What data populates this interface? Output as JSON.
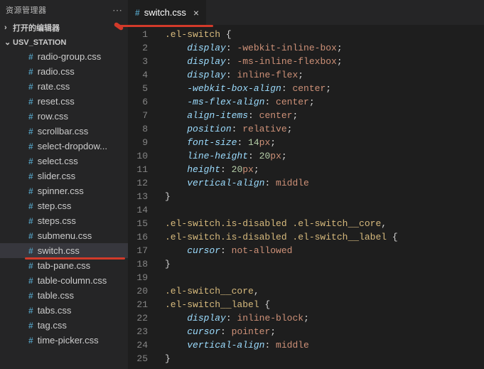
{
  "sidebar": {
    "title": "资源管理器",
    "sections": [
      {
        "label": "打开的编辑器",
        "expanded": false
      },
      {
        "label": "USV_STATION",
        "expanded": true
      }
    ],
    "files": [
      {
        "icon": "#",
        "name": "radio-group.css"
      },
      {
        "icon": "#",
        "name": "radio.css"
      },
      {
        "icon": "#",
        "name": "rate.css"
      },
      {
        "icon": "#",
        "name": "reset.css"
      },
      {
        "icon": "#",
        "name": "row.css"
      },
      {
        "icon": "#",
        "name": "scrollbar.css"
      },
      {
        "icon": "#",
        "name": "select-dropdow..."
      },
      {
        "icon": "#",
        "name": "select.css"
      },
      {
        "icon": "#",
        "name": "slider.css"
      },
      {
        "icon": "#",
        "name": "spinner.css"
      },
      {
        "icon": "#",
        "name": "step.css"
      },
      {
        "icon": "#",
        "name": "steps.css"
      },
      {
        "icon": "#",
        "name": "submenu.css"
      },
      {
        "icon": "#",
        "name": "switch.css",
        "active": true,
        "underline": true
      },
      {
        "icon": "#",
        "name": "tab-pane.css"
      },
      {
        "icon": "#",
        "name": "table-column.css"
      },
      {
        "icon": "#",
        "name": "table.css"
      },
      {
        "icon": "#",
        "name": "tabs.css"
      },
      {
        "icon": "#",
        "name": "tag.css"
      },
      {
        "icon": "#",
        "name": "time-picker.css"
      }
    ]
  },
  "tab": {
    "icon": "#",
    "label": "switch.css"
  },
  "chart_data": {
    "type": "table",
    "title": "switch.css source",
    "lines": [
      {
        "n": 1,
        "tokens": [
          {
            "t": ".el-switch",
            "c": "sel-yellow"
          },
          {
            "t": " {",
            "c": "brace"
          }
        ]
      },
      {
        "n": 2,
        "tokens": [
          {
            "t": "    "
          },
          {
            "t": "display",
            "c": "prop"
          },
          {
            "t": ": ",
            "c": "punct"
          },
          {
            "t": "-webkit-inline-box",
            "c": "val"
          },
          {
            "t": ";",
            "c": "punct"
          }
        ]
      },
      {
        "n": 3,
        "tokens": [
          {
            "t": "    "
          },
          {
            "t": "display",
            "c": "prop"
          },
          {
            "t": ": ",
            "c": "punct"
          },
          {
            "t": "-ms-inline-flexbox",
            "c": "val"
          },
          {
            "t": ";",
            "c": "punct"
          }
        ]
      },
      {
        "n": 4,
        "tokens": [
          {
            "t": "    "
          },
          {
            "t": "display",
            "c": "prop"
          },
          {
            "t": ": ",
            "c": "punct"
          },
          {
            "t": "inline-flex",
            "c": "val"
          },
          {
            "t": ";",
            "c": "punct"
          }
        ]
      },
      {
        "n": 5,
        "tokens": [
          {
            "t": "    "
          },
          {
            "t": "-webkit-box-align",
            "c": "prop"
          },
          {
            "t": ": ",
            "c": "punct"
          },
          {
            "t": "center",
            "c": "val"
          },
          {
            "t": ";",
            "c": "punct"
          }
        ]
      },
      {
        "n": 6,
        "tokens": [
          {
            "t": "    "
          },
          {
            "t": "-ms-flex-align",
            "c": "prop"
          },
          {
            "t": ": ",
            "c": "punct"
          },
          {
            "t": "center",
            "c": "val"
          },
          {
            "t": ";",
            "c": "punct"
          }
        ]
      },
      {
        "n": 7,
        "tokens": [
          {
            "t": "    "
          },
          {
            "t": "align-items",
            "c": "prop"
          },
          {
            "t": ": ",
            "c": "punct"
          },
          {
            "t": "center",
            "c": "val"
          },
          {
            "t": ";",
            "c": "punct"
          }
        ]
      },
      {
        "n": 8,
        "tokens": [
          {
            "t": "    "
          },
          {
            "t": "position",
            "c": "prop"
          },
          {
            "t": ": ",
            "c": "punct"
          },
          {
            "t": "relative",
            "c": "val"
          },
          {
            "t": ";",
            "c": "punct"
          }
        ]
      },
      {
        "n": 9,
        "tokens": [
          {
            "t": "    "
          },
          {
            "t": "font-size",
            "c": "prop"
          },
          {
            "t": ": ",
            "c": "punct"
          },
          {
            "t": "14",
            "c": "num"
          },
          {
            "t": "px",
            "c": "unit"
          },
          {
            "t": ";",
            "c": "punct"
          }
        ]
      },
      {
        "n": 10,
        "tokens": [
          {
            "t": "    "
          },
          {
            "t": "line-height",
            "c": "prop"
          },
          {
            "t": ": ",
            "c": "punct"
          },
          {
            "t": "20",
            "c": "num"
          },
          {
            "t": "px",
            "c": "unit"
          },
          {
            "t": ";",
            "c": "punct"
          }
        ]
      },
      {
        "n": 11,
        "tokens": [
          {
            "t": "    "
          },
          {
            "t": "height",
            "c": "prop"
          },
          {
            "t": ": ",
            "c": "punct"
          },
          {
            "t": "20",
            "c": "num"
          },
          {
            "t": "px",
            "c": "unit"
          },
          {
            "t": ";",
            "c": "punct"
          }
        ]
      },
      {
        "n": 12,
        "tokens": [
          {
            "t": "    "
          },
          {
            "t": "vertical-align",
            "c": "prop"
          },
          {
            "t": ": ",
            "c": "punct"
          },
          {
            "t": "middle",
            "c": "val"
          }
        ]
      },
      {
        "n": 13,
        "tokens": [
          {
            "t": "}",
            "c": "brace"
          }
        ]
      },
      {
        "n": 14,
        "tokens": []
      },
      {
        "n": 15,
        "tokens": [
          {
            "t": ".el-switch.is-disabled .el-switch__core",
            "c": "sel-yellow"
          },
          {
            "t": ",",
            "c": "punct"
          }
        ]
      },
      {
        "n": 16,
        "tokens": [
          {
            "t": ".el-switch.is-disabled .el-switch__label",
            "c": "sel-yellow"
          },
          {
            "t": " {",
            "c": "brace"
          }
        ]
      },
      {
        "n": 17,
        "tokens": [
          {
            "t": "    "
          },
          {
            "t": "cursor",
            "c": "prop"
          },
          {
            "t": ": ",
            "c": "punct"
          },
          {
            "t": "not-allowed",
            "c": "val"
          }
        ]
      },
      {
        "n": 18,
        "tokens": [
          {
            "t": "}",
            "c": "brace"
          }
        ]
      },
      {
        "n": 19,
        "tokens": []
      },
      {
        "n": 20,
        "tokens": [
          {
            "t": ".el-switch__core",
            "c": "sel-yellow"
          },
          {
            "t": ",",
            "c": "punct"
          }
        ]
      },
      {
        "n": 21,
        "tokens": [
          {
            "t": ".el-switch__label",
            "c": "sel-yellow"
          },
          {
            "t": " {",
            "c": "brace"
          }
        ]
      },
      {
        "n": 22,
        "tokens": [
          {
            "t": "    "
          },
          {
            "t": "display",
            "c": "prop"
          },
          {
            "t": ": ",
            "c": "punct"
          },
          {
            "t": "inline-block",
            "c": "val"
          },
          {
            "t": ";",
            "c": "punct"
          }
        ]
      },
      {
        "n": 23,
        "tokens": [
          {
            "t": "    "
          },
          {
            "t": "cursor",
            "c": "prop"
          },
          {
            "t": ": ",
            "c": "punct"
          },
          {
            "t": "pointer",
            "c": "val"
          },
          {
            "t": ";",
            "c": "punct"
          }
        ]
      },
      {
        "n": 24,
        "tokens": [
          {
            "t": "    "
          },
          {
            "t": "vertical-align",
            "c": "prop"
          },
          {
            "t": ": ",
            "c": "punct"
          },
          {
            "t": "middle",
            "c": "val"
          }
        ]
      },
      {
        "n": 25,
        "tokens": [
          {
            "t": "}",
            "c": "brace"
          }
        ]
      }
    ]
  }
}
